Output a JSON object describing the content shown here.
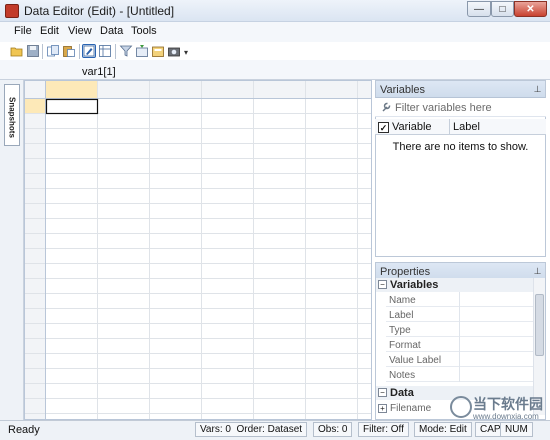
{
  "window": {
    "title": "Data Editor (Edit) - [Untitled]"
  },
  "menu": [
    "File",
    "Edit",
    "View",
    "Data",
    "Tools"
  ],
  "cell_editor": {
    "name": "var1[1]"
  },
  "snapshots": {
    "label": "Snapshots"
  },
  "variables_pane": {
    "title": "Variables",
    "filter_placeholder": "Filter variables here",
    "columns": [
      "Variable",
      "Label"
    ],
    "empty_message": "There are no items to show."
  },
  "properties_pane": {
    "title": "Properties",
    "groups": [
      {
        "label": "Variables",
        "rows": [
          "Name",
          "Label",
          "Type",
          "Format",
          "Value Label",
          "Notes"
        ]
      },
      {
        "label": "Data",
        "rows": [
          "Filename"
        ]
      }
    ]
  },
  "status": {
    "ready": "Ready",
    "vars": "Vars: 0",
    "order": "Order: Dataset",
    "obs": "Obs: 0",
    "filter": "Filter: Off",
    "mode": "Mode: Edit",
    "cap": "CAP",
    "num": "NUM"
  },
  "watermark": {
    "text": "当下软件园",
    "url": "www.downxia.com"
  },
  "icons": {
    "title": "stata-app-icon",
    "toolbar": [
      "open-icon",
      "save-icon",
      "copy-icon",
      "paste-icon",
      "edit-mode-icon",
      "browse-mode-icon",
      "filter-icon",
      "variables-window-icon",
      "properties-window-icon",
      "snapshots-icon"
    ]
  },
  "colors": {
    "selected_header": "#fde9b8",
    "grid_line": "#dfe3e8",
    "pane_header": "#d6e1ef"
  }
}
